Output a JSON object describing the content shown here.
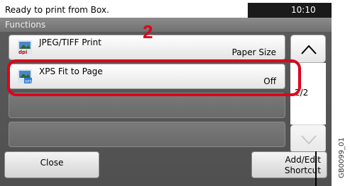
{
  "status": {
    "message": "Ready to print from Box.",
    "time": "10:10"
  },
  "panel": {
    "title": "Functions"
  },
  "rows": [
    {
      "label": "JPEG/TIFF Print",
      "value": "Paper Size",
      "icon": "jpeg-dpi-icon"
    },
    {
      "label": "XPS Fit to Page",
      "value": "Off",
      "icon": "xps-icon"
    }
  ],
  "callout": {
    "number": "2"
  },
  "scroll": {
    "page_indicator": "2/2"
  },
  "buttons": {
    "close": "Close",
    "add_edit_line1": "Add/Edit",
    "add_edit_line2": "Shortcut"
  },
  "figure_id": "GB0099_01",
  "colors": {
    "highlight": "#e2001a",
    "status_bar": "#1a1a1a"
  }
}
